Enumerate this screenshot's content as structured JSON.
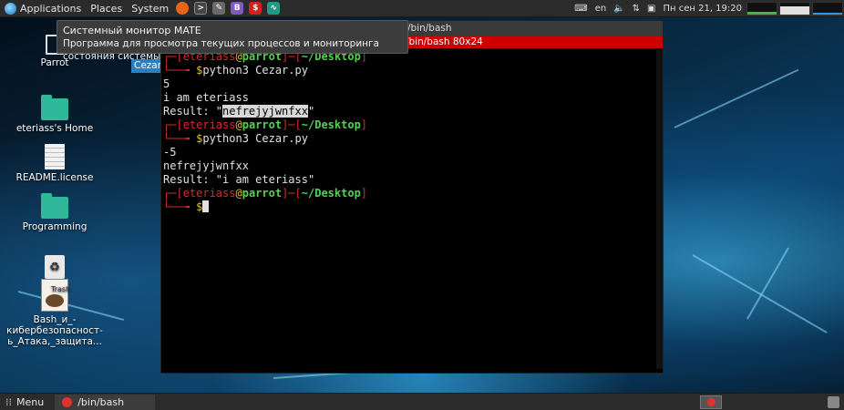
{
  "top_panel": {
    "applications": "Applications",
    "places": "Places",
    "system": "System",
    "keyboard_layout": "en",
    "datetime": "Пн сен 21, 19:20"
  },
  "tooltip": {
    "title": "Системный монитор MATE",
    "description": "Программа для просмотра текущих процессов и мониторинга состояния системы"
  },
  "desktop": {
    "icons": [
      {
        "label": "Parrot"
      },
      {
        "label": "eteriass's Home"
      },
      {
        "label": "README.license"
      },
      {
        "label": "Programming"
      },
      {
        "label": "Trash"
      },
      {
        "label_line1": "Bash_и_-",
        "label_line2": "кибербезопасност-",
        "label_line3": "ь_Атака,_защита..."
      }
    ],
    "cezar_tab": "Cezar."
  },
  "terminal": {
    "title": "/bin/bash",
    "tab_title": "/bin/bash 80x24",
    "prompt_user": "eteriass",
    "prompt_at": "@",
    "prompt_host": "parrot",
    "prompt_path": "~/Desktop",
    "command": "python3 Cezar.py",
    "lines": {
      "out1": "5",
      "out2": "i am eteriass",
      "result1_prefix": "Result: \"",
      "result1_value": "nefrejyjwnfxx",
      "result1_suffix": "\"",
      "out3": "-5",
      "out4": "nefrejyjwnfxx",
      "result2": "Result: \"i am eteriass\""
    }
  },
  "bottom_panel": {
    "menu": "Menu",
    "task": "/bin/bash"
  },
  "colors": {
    "terminal_tab": "#cc0000",
    "prompt_red": "#d82b2b",
    "prompt_green": "#55d055",
    "prompt_yellow": "#e0c030"
  }
}
